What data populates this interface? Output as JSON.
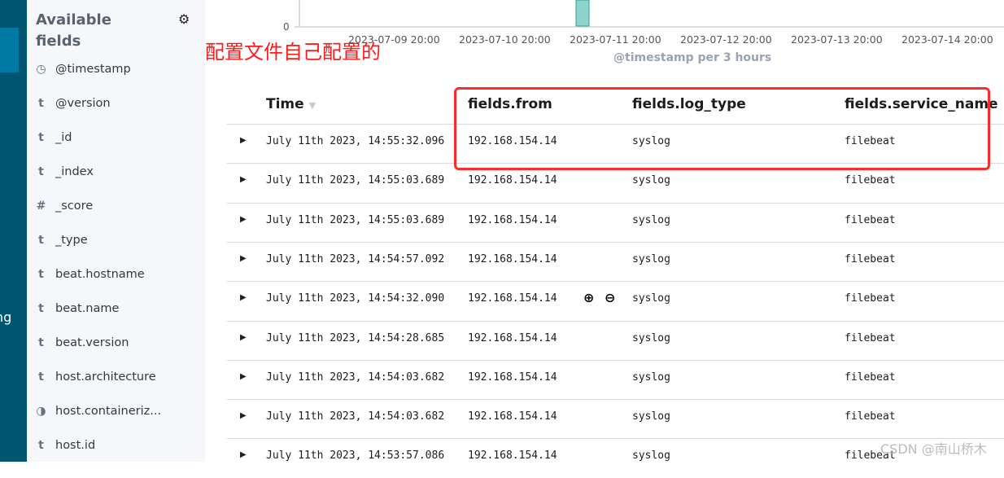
{
  "nav": {
    "partial_label": "ng"
  },
  "sidebar": {
    "title": "Available fields",
    "fields": [
      {
        "type": "clock",
        "icon": "◷",
        "name": "@timestamp"
      },
      {
        "type": "string",
        "icon": "t",
        "name": "@version"
      },
      {
        "type": "string",
        "icon": "t",
        "name": "_id"
      },
      {
        "type": "string",
        "icon": "t",
        "name": "_index"
      },
      {
        "type": "number",
        "icon": "#",
        "name": "_score"
      },
      {
        "type": "string",
        "icon": "t",
        "name": "_type"
      },
      {
        "type": "string",
        "icon": "t",
        "name": "beat.hostname"
      },
      {
        "type": "string",
        "icon": "t",
        "name": "beat.name"
      },
      {
        "type": "string",
        "icon": "t",
        "name": "beat.version"
      },
      {
        "type": "string",
        "icon": "t",
        "name": "host.architecture"
      },
      {
        "type": "boolean",
        "icon": "◑",
        "name": "host.containeriz..."
      },
      {
        "type": "string",
        "icon": "t",
        "name": "host.id"
      }
    ]
  },
  "chart_data": {
    "type": "bar",
    "y_tick": "0",
    "x_ticks": [
      "2023-07-09 20:00",
      "2023-07-10 20:00",
      "2023-07-11 20:00",
      "2023-07-12 20:00",
      "2023-07-13 20:00",
      "2023-07-14 20:00"
    ],
    "xlabel": "@timestamp per 3 hours",
    "bar_color": "#54b399"
  },
  "annotation": "配置文件自己配置的",
  "table": {
    "headers": [
      "Time",
      "fields.from",
      "fields.log_type",
      "fields.service_name"
    ],
    "rows": [
      [
        "July 11th 2023, 14:55:32.096",
        "192.168.154.14",
        "syslog",
        "filebeat"
      ],
      [
        "July 11th 2023, 14:55:03.689",
        "192.168.154.14",
        "syslog",
        "filebeat"
      ],
      [
        "July 11th 2023, 14:55:03.689",
        "192.168.154.14",
        "syslog",
        "filebeat"
      ],
      [
        "July 11th 2023, 14:54:57.092",
        "192.168.154.14",
        "syslog",
        "filebeat"
      ],
      [
        "July 11th 2023, 14:54:32.090",
        "192.168.154.14",
        "syslog",
        "filebeat"
      ],
      [
        "July 11th 2023, 14:54:28.685",
        "192.168.154.14",
        "syslog",
        "filebeat"
      ],
      [
        "July 11th 2023, 14:54:03.682",
        "192.168.154.14",
        "syslog",
        "filebeat"
      ],
      [
        "July 11th 2023, 14:54:03.682",
        "192.168.154.14",
        "syslog",
        "filebeat"
      ],
      [
        "July 11th 2023, 14:53:57.086",
        "192.168.154.14",
        "syslog",
        "filebeat"
      ]
    ]
  },
  "watermark": "CSDN @南山桥木"
}
